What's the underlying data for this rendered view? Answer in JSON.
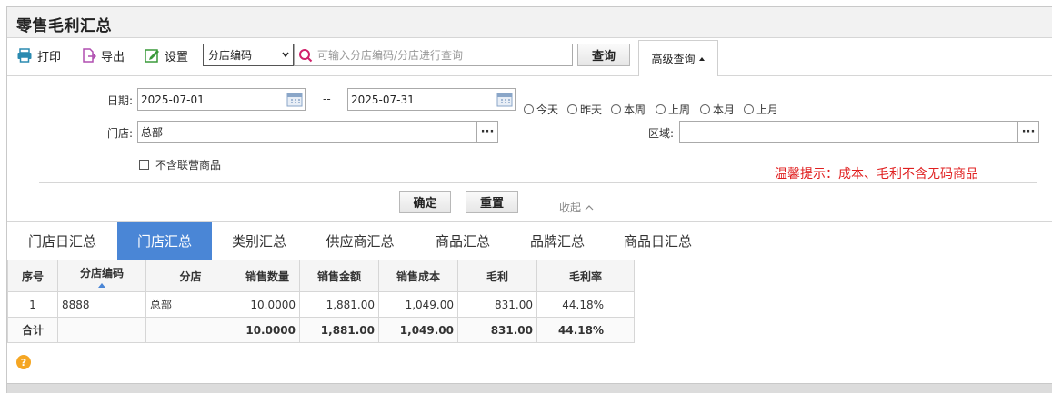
{
  "page": {
    "title": "零售毛利汇总"
  },
  "toolbar": {
    "print_label": "打印",
    "export_label": "导出",
    "settings_label": "设置",
    "search_field": "分店编码",
    "search_placeholder": "可输入分店编码/分店进行查询",
    "query_label": "查询",
    "advanced_label": "高级查询"
  },
  "filters": {
    "date_label": "日期:",
    "date_from": "2025-07-01",
    "date_sep": "--",
    "date_to": "2025-07-31",
    "quick_ranges": [
      "今天",
      "昨天",
      "本周",
      "上周",
      "本月",
      "上月"
    ],
    "store_label": "门店:",
    "store_value": "总部",
    "region_label": "区域:",
    "region_value": "",
    "exclude_joint_label": "不含联营商品",
    "tip": "温馨提示：成本、毛利不含无码商品",
    "confirm_label": "确定",
    "reset_label": "重置",
    "collapse_label": "收起"
  },
  "tabs": [
    {
      "label": "门店日汇总",
      "active": false
    },
    {
      "label": "门店汇总",
      "active": true
    },
    {
      "label": "类别汇总",
      "active": false
    },
    {
      "label": "供应商汇总",
      "active": false
    },
    {
      "label": "商品汇总",
      "active": false
    },
    {
      "label": "品牌汇总",
      "active": false
    },
    {
      "label": "商品日汇总",
      "active": false
    }
  ],
  "table": {
    "columns": [
      "序号",
      "分店编码",
      "分店",
      "销售数量",
      "销售金额",
      "销售成本",
      "毛利",
      "毛利率"
    ],
    "rows": [
      [
        "1",
        "8888",
        "总部",
        "10.0000",
        "1,881.00",
        "1,049.00",
        "831.00",
        "44.18%"
      ]
    ],
    "total": [
      "合计",
      "",
      "",
      "10.0000",
      "1,881.00",
      "1,049.00",
      "831.00",
      "44.18%"
    ]
  },
  "colors": {
    "accent": "#4a86d6",
    "warning": "#e02020",
    "help": "#f5a623"
  }
}
